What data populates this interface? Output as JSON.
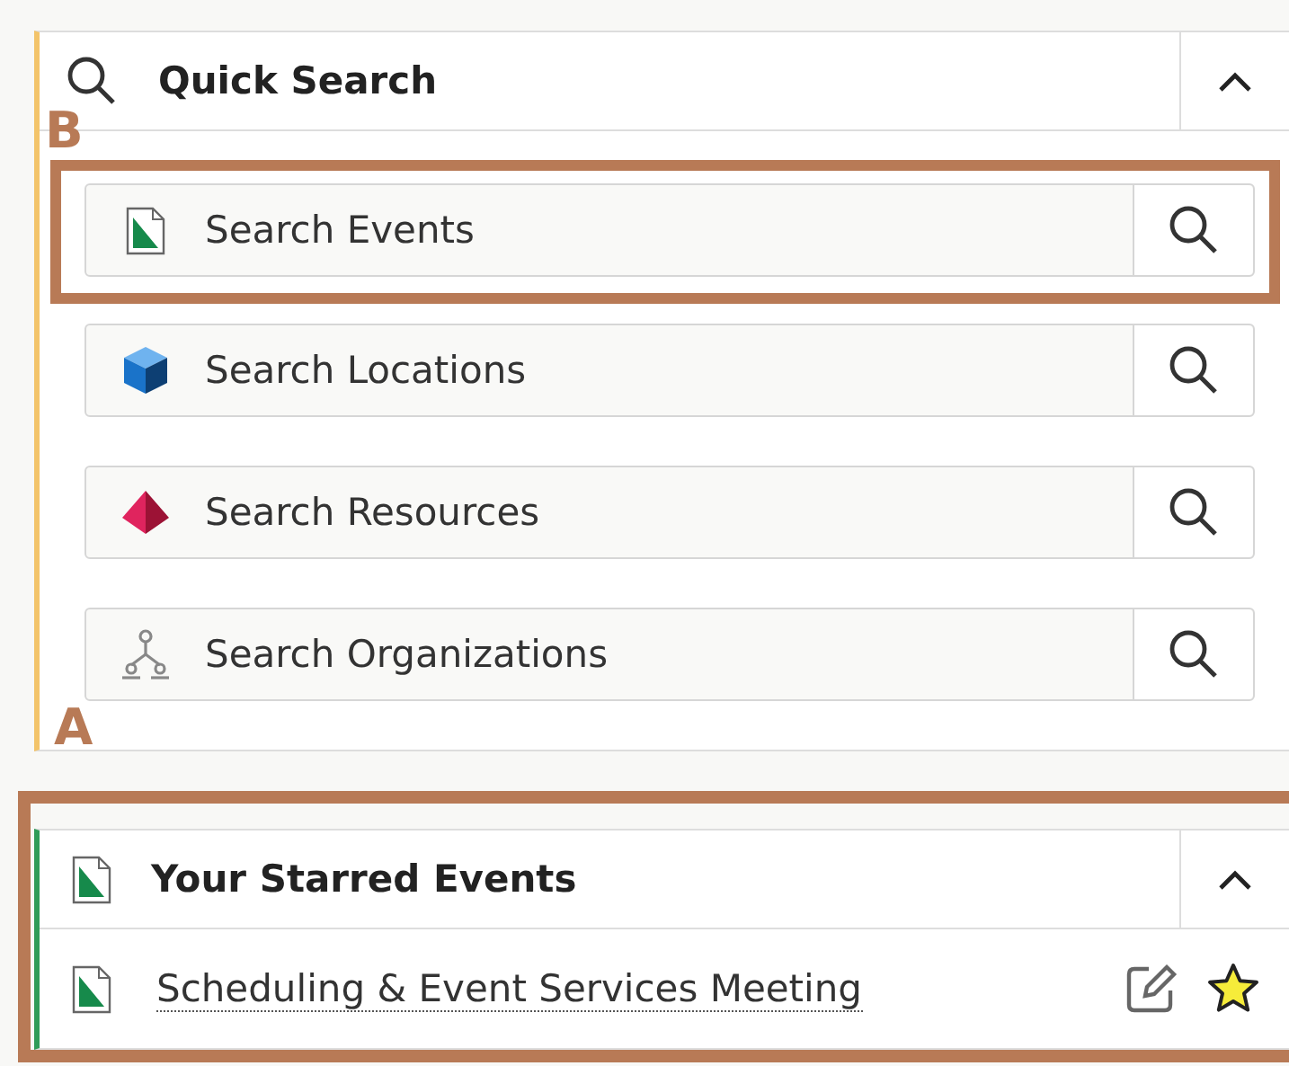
{
  "quick_search": {
    "title": "Quick Search",
    "expanded": true,
    "annotation": "B",
    "bottom_annotation": "A",
    "rows": [
      {
        "label": "Search Events",
        "kind": "event",
        "highlighted": true
      },
      {
        "label": "Search Locations",
        "kind": "location",
        "highlighted": false
      },
      {
        "label": "Search Resources",
        "kind": "resource",
        "highlighted": false
      },
      {
        "label": "Search Organizations",
        "kind": "organization",
        "highlighted": false
      }
    ]
  },
  "starred_events": {
    "title": "Your Starred Events",
    "expanded": true,
    "highlighted": true,
    "items": [
      {
        "label": "Scheduling & Event Services Meeting",
        "starred": true
      }
    ]
  }
}
